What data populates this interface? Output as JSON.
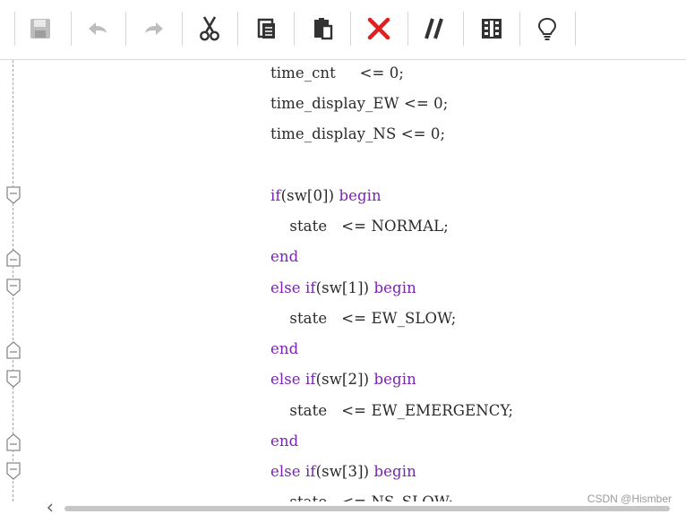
{
  "toolbar": {
    "buttons": [
      "save-icon",
      "undo-icon",
      "redo-icon",
      "cut-icon",
      "copy-icon",
      "paste-icon",
      "delete-icon",
      "comment-icon",
      "column-icon",
      "lightbulb-icon"
    ]
  },
  "code": {
    "line1": {
      "text": "time_cnt     <= 0;"
    },
    "line2": {
      "text": "time_display_EW <= 0;"
    },
    "line3": {
      "text": "time_display_NS <= 0;"
    },
    "line5": {
      "kw": "if",
      "rest": "(sw[0]) ",
      "kw2": "begin"
    },
    "line6": {
      "text": "    state   <= NORMAL;"
    },
    "line7": {
      "kw": "end"
    },
    "line8": {
      "kw": "else if",
      "rest": "(sw[1]) ",
      "kw2": "begin"
    },
    "line9": {
      "text": "    state   <= EW_SLOW;"
    },
    "line10": {
      "kw": "end"
    },
    "line11": {
      "kw": "else if",
      "rest": "(sw[2]) ",
      "kw2": "begin"
    },
    "line12": {
      "text": "    state   <= EW_EMERGENCY;"
    },
    "line13": {
      "kw": "end"
    },
    "line14": {
      "kw": "else if",
      "rest": "(sw[3]) ",
      "kw2": "begin"
    },
    "line15": {
      "text": "    state   <= NS_SLOW;"
    }
  },
  "watermark": "CSDN @Hismber",
  "colors": {
    "keyword": "#7a23b5",
    "delete_icon": "#e02020"
  }
}
